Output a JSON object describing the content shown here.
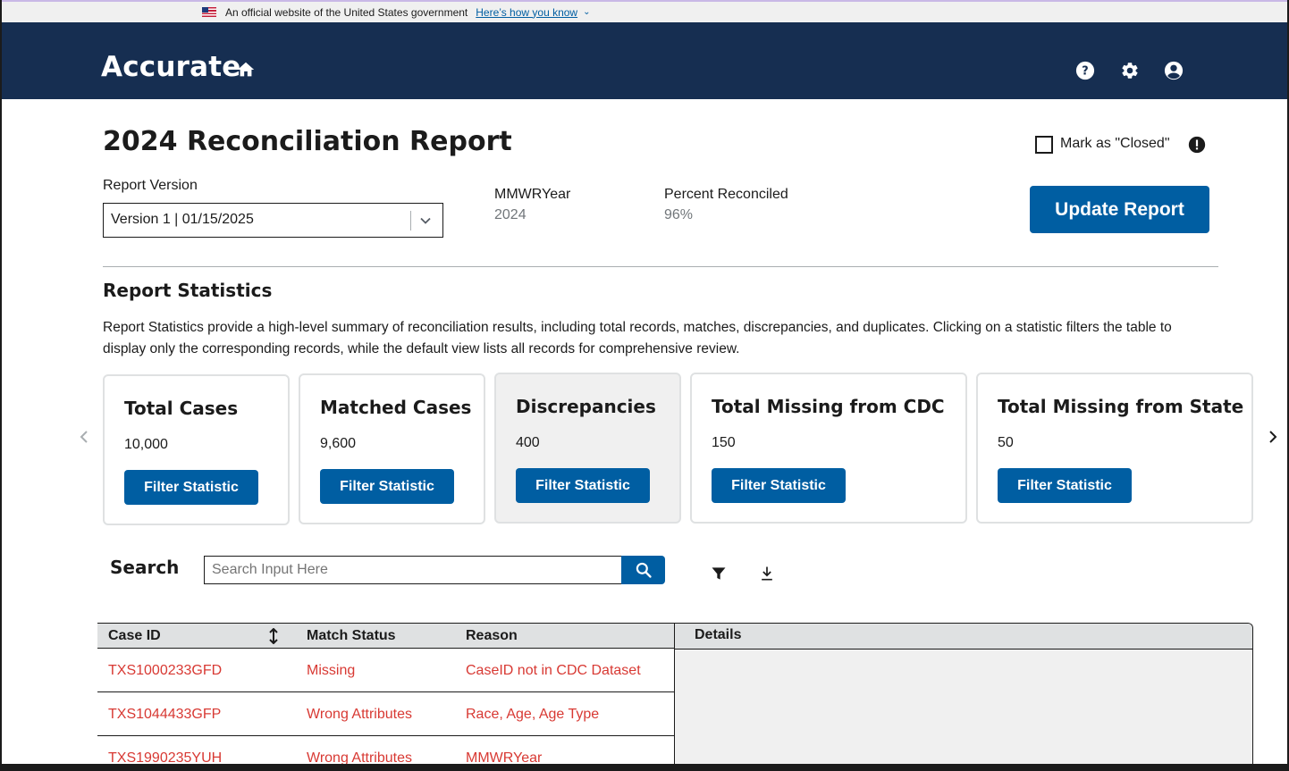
{
  "banner": {
    "text": "An official website of the United States government",
    "link": "Here’s how you know"
  },
  "header": {
    "brand": "Accurate",
    "icons": [
      "home-icon",
      "help-icon",
      "settings-icon",
      "account-icon"
    ]
  },
  "page": {
    "title": "2024 Reconciliation Report",
    "mark_closed_label": "Mark as \"Closed\"",
    "mark_closed_checked": false
  },
  "report_version": {
    "label": "Report Version",
    "selected": "Version 1 | 01/15/2025"
  },
  "meta": {
    "mmwr_label": "MMWRYear",
    "mmwr_value": "2024",
    "percent_label": "Percent Reconciled",
    "percent_value": "96%"
  },
  "update_button": "Update Report",
  "stats": {
    "heading": "Report Statistics",
    "description": "Report Statistics provide a high-level summary of reconciliation results, including total records, matches, discrepancies, and duplicates. Clicking on a statistic filters the table to display only the corresponding records, while the default view lists all records for comprehensive review.",
    "cards": [
      {
        "title": "Total Cases",
        "value": "10,000",
        "button": "Filter Statistic"
      },
      {
        "title": "Matched Cases",
        "value": "9,600",
        "button": "Filter Statistic"
      },
      {
        "title": "Discrepancies",
        "value": "400",
        "button": "Filter Statistic"
      },
      {
        "title": "Total Missing from CDC",
        "value": "150",
        "button": "Filter Statistic"
      },
      {
        "title": "Total Missing from State",
        "value": "50",
        "button": "Filter Statistic"
      }
    ]
  },
  "search": {
    "label": "Search",
    "placeholder": "Search Input Here"
  },
  "table": {
    "headers": [
      "Case ID",
      "Match Status",
      "Reason"
    ],
    "rows": [
      [
        "TXS1000233GFD",
        "Missing",
        "CaseID not in CDC Dataset"
      ],
      [
        "TXS1044433GFP",
        "Wrong Attributes",
        "Race, Age, Age Type"
      ],
      [
        "TXS1990235YUH",
        "Wrong Attributes",
        "MMWRYear"
      ]
    ]
  },
  "details": {
    "title": "Details"
  },
  "colors": {
    "header_bg": "#162e51",
    "primary": "#005ea2",
    "error_text": "#d83933"
  }
}
